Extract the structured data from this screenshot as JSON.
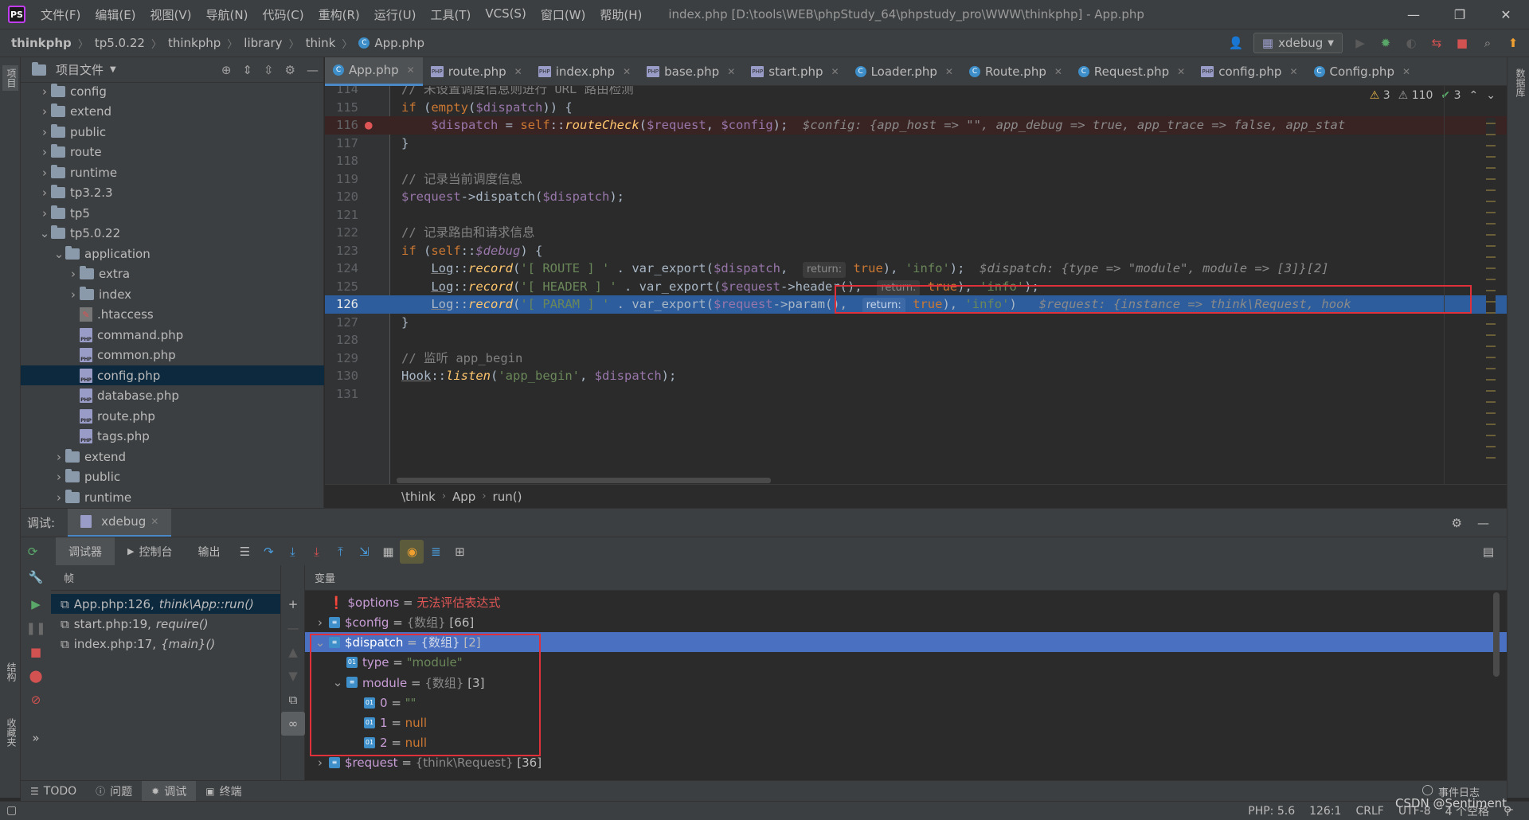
{
  "app": {
    "logo": "PS",
    "window_title": "index.php [D:\\tools\\WEB\\phpStudy_64\\phpstudy_pro\\WWW\\thinkphp] - App.php"
  },
  "menu": [
    "文件(F)",
    "编辑(E)",
    "视图(V)",
    "导航(N)",
    "代码(C)",
    "重构(R)",
    "运行(U)",
    "工具(T)",
    "VCS(S)",
    "窗口(W)",
    "帮助(H)"
  ],
  "window_controls": {
    "minimize": "—",
    "restore": "❐",
    "close": "✕"
  },
  "navbar": {
    "breadcrumbs": [
      "thinkphp",
      "tp5.0.22",
      "thinkphp",
      "library",
      "think",
      "App.php"
    ],
    "run_config": "xdebug"
  },
  "left_stripe": {
    "project_tab": "项目",
    "structure_tab": "结构",
    "favorites_tab": "收藏夹"
  },
  "right_stripe": {
    "database_tab": "数据库"
  },
  "project": {
    "title": "项目文件",
    "tree": [
      {
        "label": "config",
        "kind": "folder",
        "depth": 1,
        "expanded": false
      },
      {
        "label": "extend",
        "kind": "folder",
        "depth": 1,
        "expanded": false
      },
      {
        "label": "public",
        "kind": "folder",
        "depth": 1,
        "expanded": false
      },
      {
        "label": "route",
        "kind": "folder",
        "depth": 1,
        "expanded": false
      },
      {
        "label": "runtime",
        "kind": "folder",
        "depth": 1,
        "expanded": false
      },
      {
        "label": "tp3.2.3",
        "kind": "folder",
        "depth": 1,
        "expanded": false
      },
      {
        "label": "tp5",
        "kind": "folder",
        "depth": 1,
        "expanded": false
      },
      {
        "label": "tp5.0.22",
        "kind": "folder",
        "depth": 1,
        "expanded": true
      },
      {
        "label": "application",
        "kind": "folder",
        "depth": 2,
        "expanded": true
      },
      {
        "label": "extra",
        "kind": "folder",
        "depth": 3,
        "expanded": false
      },
      {
        "label": "index",
        "kind": "folder",
        "depth": 3,
        "expanded": false
      },
      {
        "label": ".htaccess",
        "kind": "ht",
        "depth": 3
      },
      {
        "label": "command.php",
        "kind": "php",
        "depth": 3
      },
      {
        "label": "common.php",
        "kind": "php",
        "depth": 3
      },
      {
        "label": "config.php",
        "kind": "php",
        "depth": 3,
        "selected": true
      },
      {
        "label": "database.php",
        "kind": "php",
        "depth": 3
      },
      {
        "label": "route.php",
        "kind": "php",
        "depth": 3
      },
      {
        "label": "tags.php",
        "kind": "php",
        "depth": 3
      },
      {
        "label": "extend",
        "kind": "folder",
        "depth": 2,
        "expanded": false
      },
      {
        "label": "public",
        "kind": "folder",
        "depth": 2,
        "expanded": false
      },
      {
        "label": "runtime",
        "kind": "folder",
        "depth": 2,
        "expanded": false
      }
    ]
  },
  "tabs": [
    {
      "label": "App.php",
      "kind": "class",
      "active": true
    },
    {
      "label": "route.php",
      "kind": "php"
    },
    {
      "label": "index.php",
      "kind": "php"
    },
    {
      "label": "base.php",
      "kind": "php"
    },
    {
      "label": "start.php",
      "kind": "php"
    },
    {
      "label": "Loader.php",
      "kind": "class"
    },
    {
      "label": "Route.php",
      "kind": "class"
    },
    {
      "label": "Request.php",
      "kind": "class"
    },
    {
      "label": "config.php",
      "kind": "php"
    },
    {
      "label": "Config.php",
      "kind": "class"
    }
  ],
  "inspections": {
    "errors": "3",
    "warnings": "110",
    "ok": "3"
  },
  "code_lines": [
    {
      "n": "114",
      "html": "<span class=\"cm\">// 未设置调度信息则进行 URL 路由检测</span>"
    },
    {
      "n": "115",
      "html": "<span class=\"kw\">if</span> (<span class=\"kw\">empty</span>(<span class=\"var\">$dispatch</span>)) {"
    },
    {
      "n": "116",
      "html": "    <span class=\"var\">$dispatch</span> = <span class=\"kw\">self</span>::<span class=\"fn\">routeCheck</span>(<span class=\"var\">$request</span>, <span class=\"var\">$config</span>);  <span class=\"ghost\">$config: {app_host =&gt; \"\", app_debug =&gt; true, app_trace =&gt; false, app_stat</span>",
      "bp": true
    },
    {
      "n": "117",
      "html": "}"
    },
    {
      "n": "118",
      "html": ""
    },
    {
      "n": "119",
      "html": "<span class=\"cm\">// 记录当前调度信息</span>"
    },
    {
      "n": "120",
      "html": "<span class=\"var\">$request</span>-&gt;<span class=\"kw\" style=\"color:#a9b7c6\">dispatch</span>(<span class=\"var\">$dispatch</span>);"
    },
    {
      "n": "121",
      "html": ""
    },
    {
      "n": "122",
      "html": "<span class=\"cm\">// 记录路由和请求信息</span>"
    },
    {
      "n": "123",
      "html": "<span class=\"kw\">if</span> (<span class=\"kw\">self</span>::<span class=\"var\" style=\"font-style:italic\">$debug</span>) {"
    },
    {
      "n": "124",
      "html": "    <span class=\"cls\">Log</span>::<span class=\"fn\">record</span>(<span class=\"str\">'[ ROUTE ] '</span> . var_export(<span class=\"var\">$dispatch</span>,  <span class=\"hint\">return:</span> <span class=\"kw\">true</span>), <span class=\"str\">'info'</span>);  <span class=\"ghost\">$dispatch: {type =&gt; \"module\", module =&gt; [3]}[2]</span>"
    },
    {
      "n": "125",
      "html": "    <span class=\"cls\">Log</span>::<span class=\"fn\">record</span>(<span class=\"str\">'[ HEADER ] '</span> . var_export(<span class=\"var\">$request</span>-&gt;header(),  <span class=\"hint\">return:</span> <span class=\"kw\">true</span>), <span class=\"str\">'info'</span>);"
    },
    {
      "n": "126",
      "html": "    <span class=\"cls\">Log</span>::<span class=\"fn\">record</span>(<span class=\"str\">'[ PARAM ] '</span> . var_export(<span class=\"var\">$request</span>-&gt;param(),  <span class=\"hint\">return:</span> <span class=\"kw\">true</span>), <span class=\"str\">'info'</span>)   <span class=\"ghost\">$request: {instance =&gt; think\\Request, hook</span>",
      "exec": true
    },
    {
      "n": "127",
      "html": "}"
    },
    {
      "n": "128",
      "html": ""
    },
    {
      "n": "129",
      "html": "<span class=\"cm\">// 监听 app_begin</span>"
    },
    {
      "n": "130",
      "html": "<span class=\"cls\">Hook</span>::<span class=\"fn\">listen</span>(<span class=\"str\">'app_begin'</span>, <span class=\"var\">$dispatch</span>);"
    },
    {
      "n": "131",
      "html": ""
    }
  ],
  "editor_breadcrumb": [
    "\\think",
    "App",
    "run()"
  ],
  "debug": {
    "label": "调试:",
    "session": "xdebug",
    "tabs": [
      "调试器",
      "控制台",
      "输出"
    ],
    "frames_header": "帧",
    "frames": [
      {
        "loc": "App.php:126,",
        "fn": "think\\App::run()",
        "selected": true
      },
      {
        "loc": "start.php:19,",
        "fn": "require()"
      },
      {
        "loc": "index.php:17,",
        "fn": "{main}()"
      }
    ],
    "vars_header": "变量",
    "vars": [
      {
        "html": "<span class=\"err\">❗</span>&nbsp;<span class=\"vname\">$options</span>&nbsp;=&nbsp;<span class=\"err\">无法评估表达式</span>",
        "indent": 0
      },
      {
        "html": "<span class=\"vname\">$config</span>&nbsp;=&nbsp;<span class=\"vtype\">{数组}</span>&nbsp;[66]",
        "indent": 0,
        "arrow": "›",
        "icon": "arr"
      },
      {
        "html": "<span class=\"vname\">$dispatch</span>&nbsp;=&nbsp;<span class=\"vtype\">{数组}</span>&nbsp;[2]",
        "indent": 0,
        "arrow": "⌄",
        "icon": "arr",
        "selected": true
      },
      {
        "html": "<span class=\"vname\">type</span>&nbsp;=&nbsp;<span class=\"vstr\">\"module\"</span>",
        "indent": 1,
        "icon": "val"
      },
      {
        "html": "<span class=\"vname\">module</span>&nbsp;=&nbsp;<span class=\"vtype\">{数组}</span>&nbsp;[3]",
        "indent": 1,
        "arrow": "⌄",
        "icon": "arr"
      },
      {
        "html": "<span class=\"vname\">0</span>&nbsp;=&nbsp;<span class=\"vstr\">\"\"</span>",
        "indent": 2,
        "icon": "val"
      },
      {
        "html": "<span class=\"vname\">1</span>&nbsp;=&nbsp;<span class=\"vkw\">null</span>",
        "indent": 2,
        "icon": "val"
      },
      {
        "html": "<span class=\"vname\">2</span>&nbsp;=&nbsp;<span class=\"vkw\">null</span>",
        "indent": 2,
        "icon": "val"
      },
      {
        "html": "<span class=\"vname\">$request</span>&nbsp;=&nbsp;<span class=\"vtype\">{think\\Request}</span>&nbsp;[36]",
        "indent": 0,
        "arrow": "›",
        "icon": "arr"
      }
    ]
  },
  "bottom_tabs": [
    "TODO",
    "问题",
    "调试",
    "终端"
  ],
  "event_log": "事件日志",
  "status": {
    "php": "PHP: 5.6",
    "pos": "126:1",
    "eol": "CRLF",
    "enc": "UTF-8",
    "indent": "4 个空格"
  },
  "watermark": "CSDN @Sentiment_"
}
